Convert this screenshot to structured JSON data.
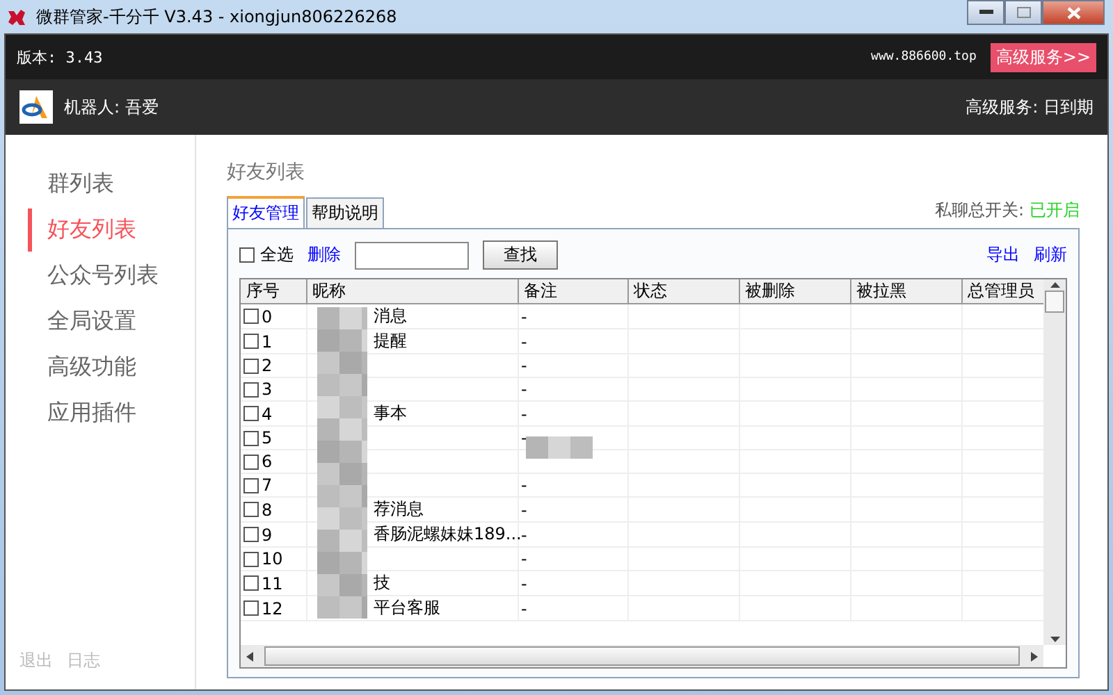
{
  "window": {
    "title": "微群管家-千分千 V3.43 - xiongjun806226268"
  },
  "header": {
    "version": "版本: 3.43",
    "website": "www.886600.top",
    "upgrade_button": "高级服务>>",
    "robot": "机器人: 吾爱",
    "service_status": "高级服务: 日到期"
  },
  "sidebar": {
    "items": [
      {
        "label": "群列表",
        "selected": false
      },
      {
        "label": "好友列表",
        "selected": true
      },
      {
        "label": "公众号列表",
        "selected": false
      },
      {
        "label": "全局设置",
        "selected": false
      },
      {
        "label": "高级功能",
        "selected": false
      },
      {
        "label": "应用插件",
        "selected": false
      }
    ],
    "footer_links": [
      "退出",
      "日志"
    ]
  },
  "content": {
    "title": "好友列表",
    "tabs": [
      {
        "label": "好友管理",
        "selected": true
      },
      {
        "label": "帮助说明",
        "selected": false
      }
    ],
    "private_chat_switch": {
      "label": "私聊总开关:",
      "value": "已开启",
      "on": true
    },
    "toolbar": {
      "select_all": {
        "label": "全选",
        "checked": false
      },
      "delete": "删除",
      "search_button": "查找",
      "export": "导出",
      "refresh": "刷新"
    },
    "table": {
      "columns": [
        "序号",
        "昵称",
        "备注",
        "状态",
        "被删除",
        "被拉黑",
        "总管理员"
      ],
      "rows": [
        {
          "index": "0",
          "nickname": "消息",
          "remark": "-",
          "checked": false
        },
        {
          "index": "1",
          "nickname": "提醒",
          "remark": "-",
          "checked": false
        },
        {
          "index": "2",
          "nickname": "",
          "remark": "-",
          "checked": false
        },
        {
          "index": "3",
          "nickname": "",
          "remark": "-",
          "checked": false
        },
        {
          "index": "4",
          "nickname": "事本",
          "remark": "-",
          "checked": false
        },
        {
          "index": "5",
          "nickname": "",
          "remark": "-",
          "checked": false
        },
        {
          "index": "6",
          "nickname": "",
          "remark": "",
          "checked": false
        },
        {
          "index": "7",
          "nickname": "",
          "remark": "-",
          "checked": false
        },
        {
          "index": "8",
          "nickname": "荐消息",
          "remark": "-",
          "checked": false
        },
        {
          "index": "9",
          "nickname": "香肠泥螺妹妹189...",
          "remark": "-",
          "checked": false
        },
        {
          "index": "10",
          "nickname": "",
          "remark": "-",
          "checked": false
        },
        {
          "index": "11",
          "nickname": "技",
          "remark": "-",
          "checked": false
        },
        {
          "index": "12",
          "nickname": "平台客服",
          "remark": "-",
          "checked": false
        }
      ]
    }
  }
}
